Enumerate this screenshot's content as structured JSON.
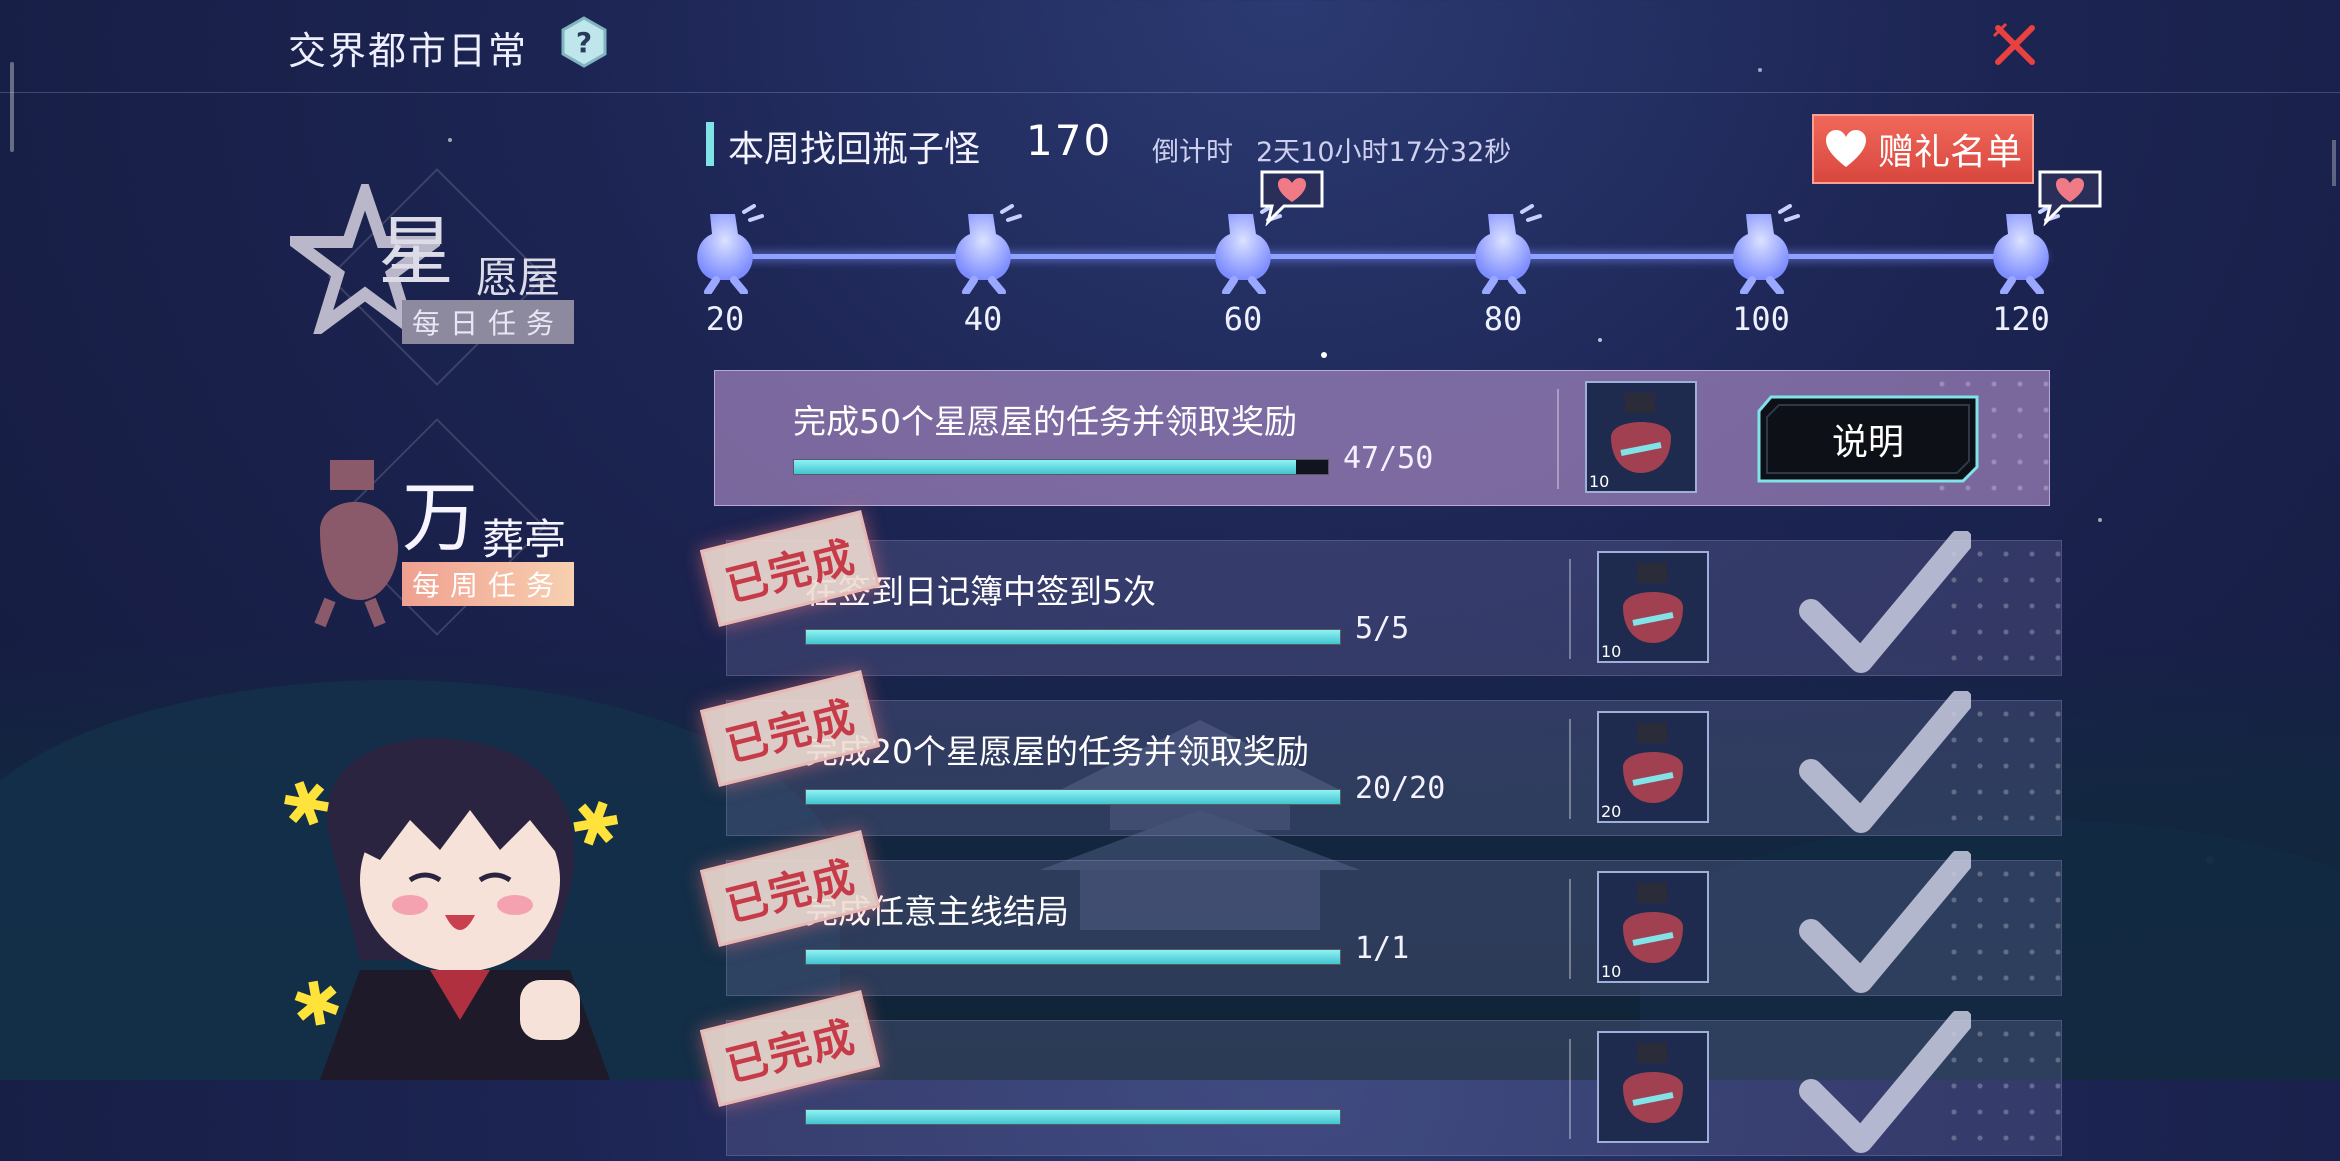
{
  "header": {
    "title": "交界都市日常",
    "weekly_label": "本周找回瓶子怪",
    "weekly_count": "170",
    "countdown_label": "倒计时",
    "countdown_value": "2天10小时17分32秒",
    "gift_button_label": "赠礼名单"
  },
  "milestones": [
    {
      "value": "20",
      "has_heart": false
    },
    {
      "value": "40",
      "has_heart": false
    },
    {
      "value": "60",
      "has_heart": true
    },
    {
      "value": "80",
      "has_heart": false
    },
    {
      "value": "100",
      "has_heart": false
    },
    {
      "value": "120",
      "has_heart": true
    }
  ],
  "nav": {
    "items": [
      {
        "big": "星",
        "small": "愿屋",
        "tag": "每日任务",
        "selected": false
      },
      {
        "big": "万",
        "small": "葬亭",
        "tag": "每周任务",
        "selected": true
      }
    ]
  },
  "tasks": [
    {
      "text": "完成50个星愿屋的任务并领取奖励",
      "progress_text": "47/50",
      "progress": 0.94,
      "reward_qty": "10",
      "status": "in_progress",
      "action_label": "说明"
    },
    {
      "text": "在签到日记簿中签到5次",
      "progress_text": "5/5",
      "progress": 1.0,
      "reward_qty": "10",
      "status": "completed",
      "stamp": "已完成"
    },
    {
      "text": "完成20个星愿屋的任务并领取奖励",
      "progress_text": "20/20",
      "progress": 1.0,
      "reward_qty": "20",
      "status": "completed",
      "stamp": "已完成"
    },
    {
      "text": "完成任意主线结局",
      "progress_text": "1/1",
      "progress": 1.0,
      "reward_qty": "10",
      "status": "completed",
      "stamp": "已完成"
    },
    {
      "text": "",
      "progress_text": "",
      "progress": 1.0,
      "reward_qty": "",
      "status": "completed",
      "stamp": "已完成"
    }
  ],
  "colors": {
    "accent_teal": "#7fe3e8",
    "gift_red": "#e0554a",
    "close_red": "#e8413f",
    "milestone_blue": "#8fa2ff"
  }
}
